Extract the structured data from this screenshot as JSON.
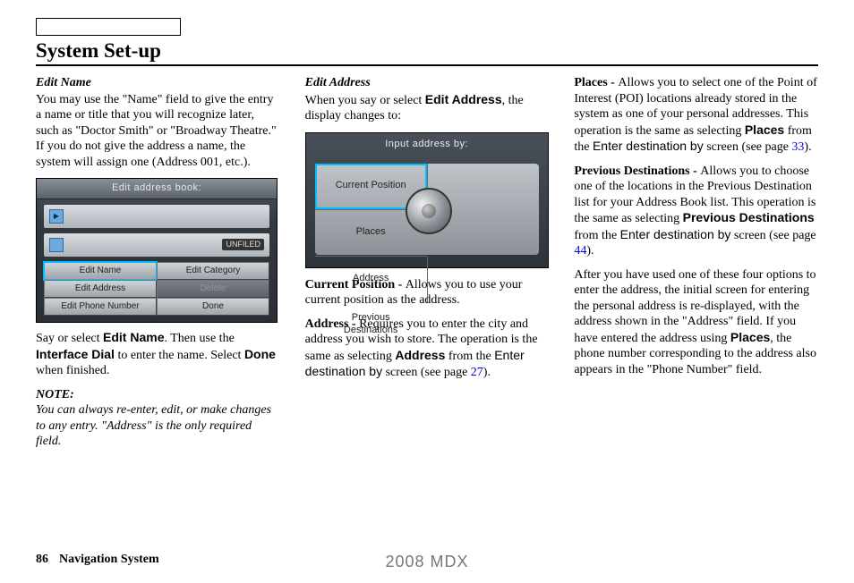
{
  "header": {
    "title": "System Set-up"
  },
  "footer": {
    "page": "86",
    "section": "Navigation System",
    "model": "2008 MDX"
  },
  "col1": {
    "h1": "Edit Name",
    "p1": "You may use the \"Name\" field to give the entry a name or title that you will recognize later, such as \"Doctor Smith\" or \"Broadway Theatre.\" If you do not give the address a name, the system will assign one (Address 001, etc.).",
    "shot": {
      "title": "Edit address book:",
      "tag": "UNFILED",
      "btns": [
        "Edit Name",
        "Edit Category",
        "Edit Address",
        "Delete",
        "Edit Phone Number",
        "Done"
      ]
    },
    "p2a": "Say or select ",
    "p2b": "Edit Name",
    "p2c": ". Then use the ",
    "p2d": "Interface Dial",
    "p2e": " to enter the name. Select ",
    "p2f": "Done",
    "p2g": " when finished.",
    "noteHead": "NOTE:",
    "noteBody": "You can always re-enter, edit, or make changes to any entry. \"Address\" is the only required field."
  },
  "col2": {
    "h1": "Edit Address",
    "p1a": "When you say or select ",
    "p1b": "Edit Address",
    "p1c": ", the display changes to:",
    "shot": {
      "title": "Input address by:",
      "cells": [
        "Current Position",
        "Places",
        "Address",
        "Previous\nDestinations"
      ]
    },
    "p2a": "Current Position - ",
    "p2b": "Allows you to use your current position as the address.",
    "p3a": "Address - ",
    "p3b": "Requires you to enter the city and address you wish to store. The operation is the same as selecting ",
    "p3c": "Address",
    "p3d": " from the ",
    "p3e": "Enter destination by",
    "p3f": " screen (see page ",
    "p3g": "27",
    "p3h": ")."
  },
  "col3": {
    "p1a": "Places - ",
    "p1b": "Allows you to select one of the Point of Interest (POI) locations already stored in the system as one of your personal addresses. This operation is the same as selecting ",
    "p1c": "Places",
    "p1d": " from the ",
    "p1e": "Enter destination by",
    "p1f": " screen (see page ",
    "p1g": "33",
    "p1h": ").",
    "p2a": "Previous Destinations - ",
    "p2b": "Allows you to choose one of the locations in the Previous Destination list for your Address Book list. This operation is the same as selecting ",
    "p2c": "Previous Destinations",
    "p2d": " from the ",
    "p2e": "Enter destination by",
    "p2f": " screen (see page ",
    "p2g": "44",
    "p2h": ").",
    "p3a": "After you have used one of these four options to enter the address, the initial screen for entering the personal address is re-displayed, with the address shown in the \"Address\" field. If you have entered the address using ",
    "p3b": "Places",
    "p3c": ", the phone number corresponding to the address also appears in the \"Phone Number\" field."
  }
}
